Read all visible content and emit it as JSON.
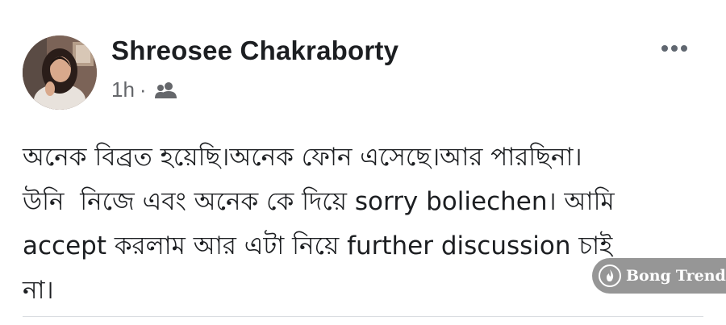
{
  "post": {
    "author": "Shreosee Chakraborty",
    "time": "1h",
    "separator": "·",
    "audience_icon": "friends-icon",
    "body": "অনেক বিব্রত হয়েছি।অনেক ফোন এসেছে।আর পারছিনা।\nউনি  নিজে এবং অনেক কে দিয়ে sorry boliechen। আমি\naccept করলাম আর এটা নিয়ে further discussion চাই\nনা।"
  },
  "watermark": {
    "brand_first": "Bong",
    "brand_second": "Trend"
  }
}
